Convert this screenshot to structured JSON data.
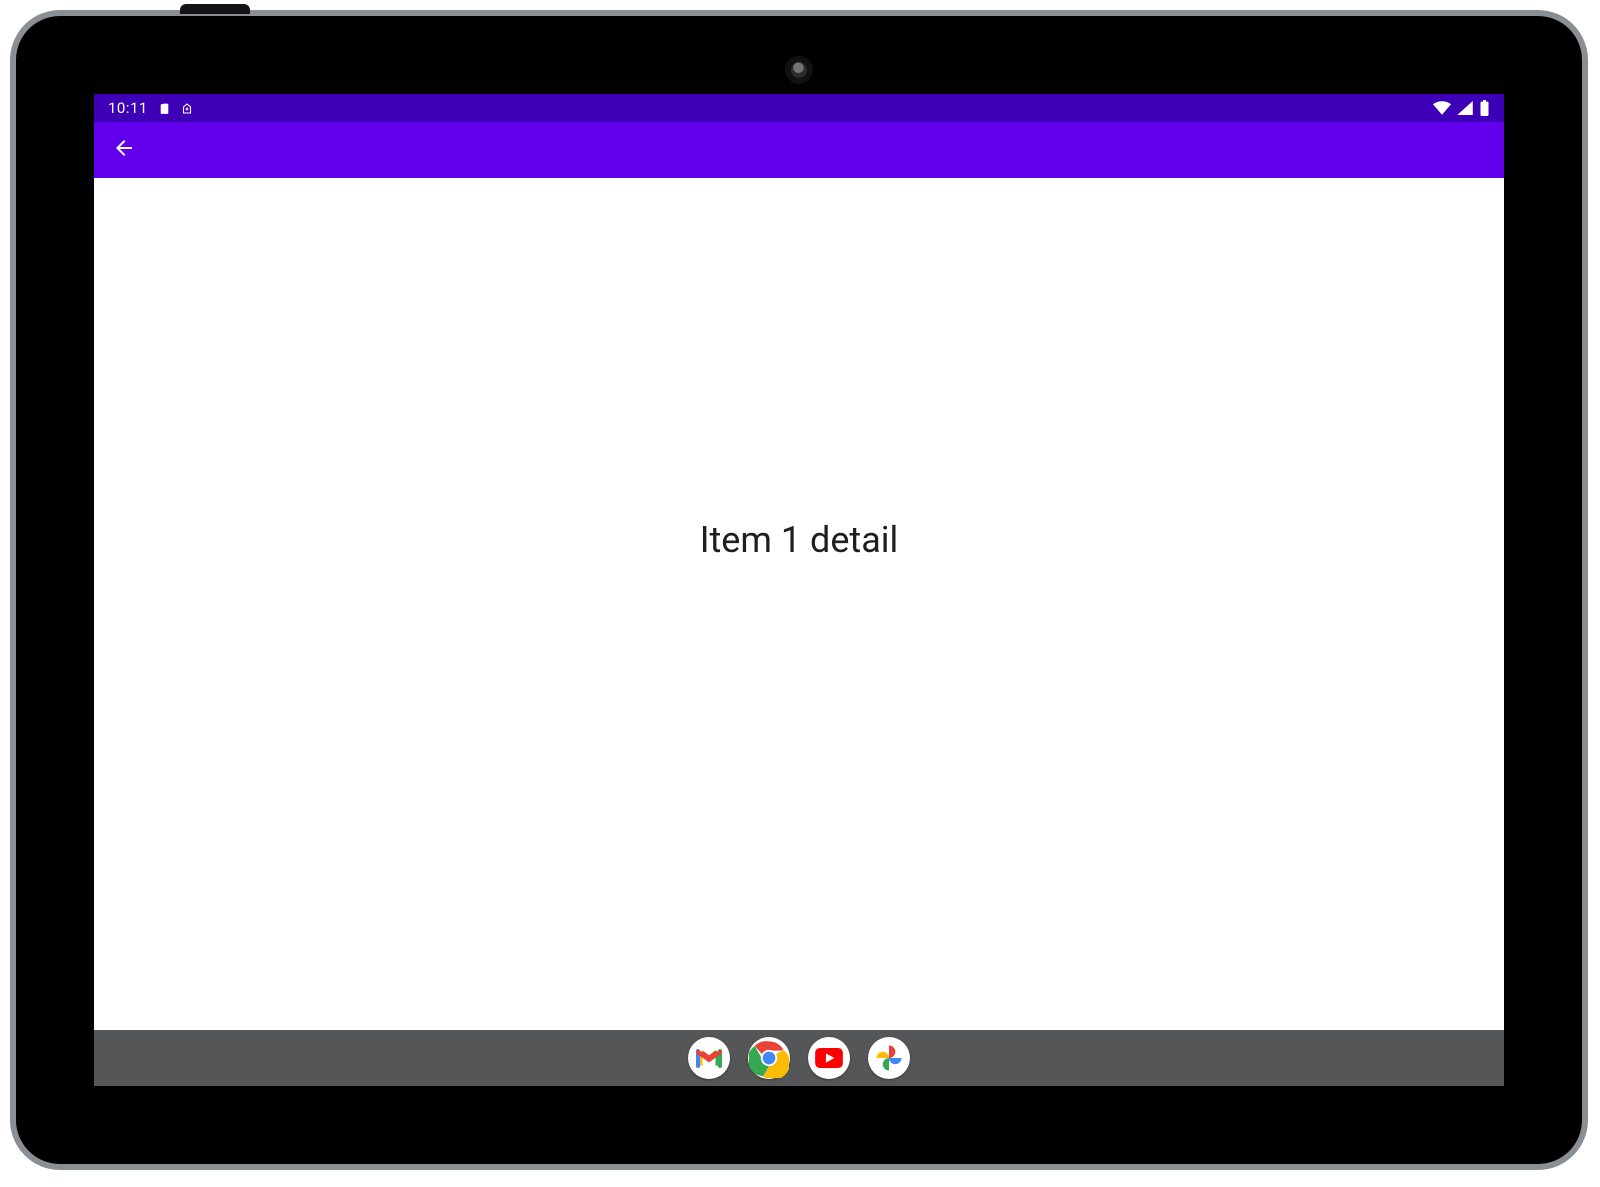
{
  "status_bar": {
    "time": "10:11",
    "icons_left": [
      "sim-card-icon",
      "battery-saver-icon"
    ],
    "icons_right": [
      "wifi-icon",
      "cell-signal-icon",
      "battery-icon"
    ]
  },
  "app_bar": {
    "back_icon": "arrow-back-icon"
  },
  "content": {
    "detail_text": "Item 1 detail"
  },
  "shelf": {
    "apps": [
      {
        "name": "gmail-app-icon",
        "label": "Gmail"
      },
      {
        "name": "chrome-app-icon",
        "label": "Chrome"
      },
      {
        "name": "youtube-app-icon",
        "label": "YouTube"
      },
      {
        "name": "photos-app-icon",
        "label": "Photos"
      }
    ]
  }
}
